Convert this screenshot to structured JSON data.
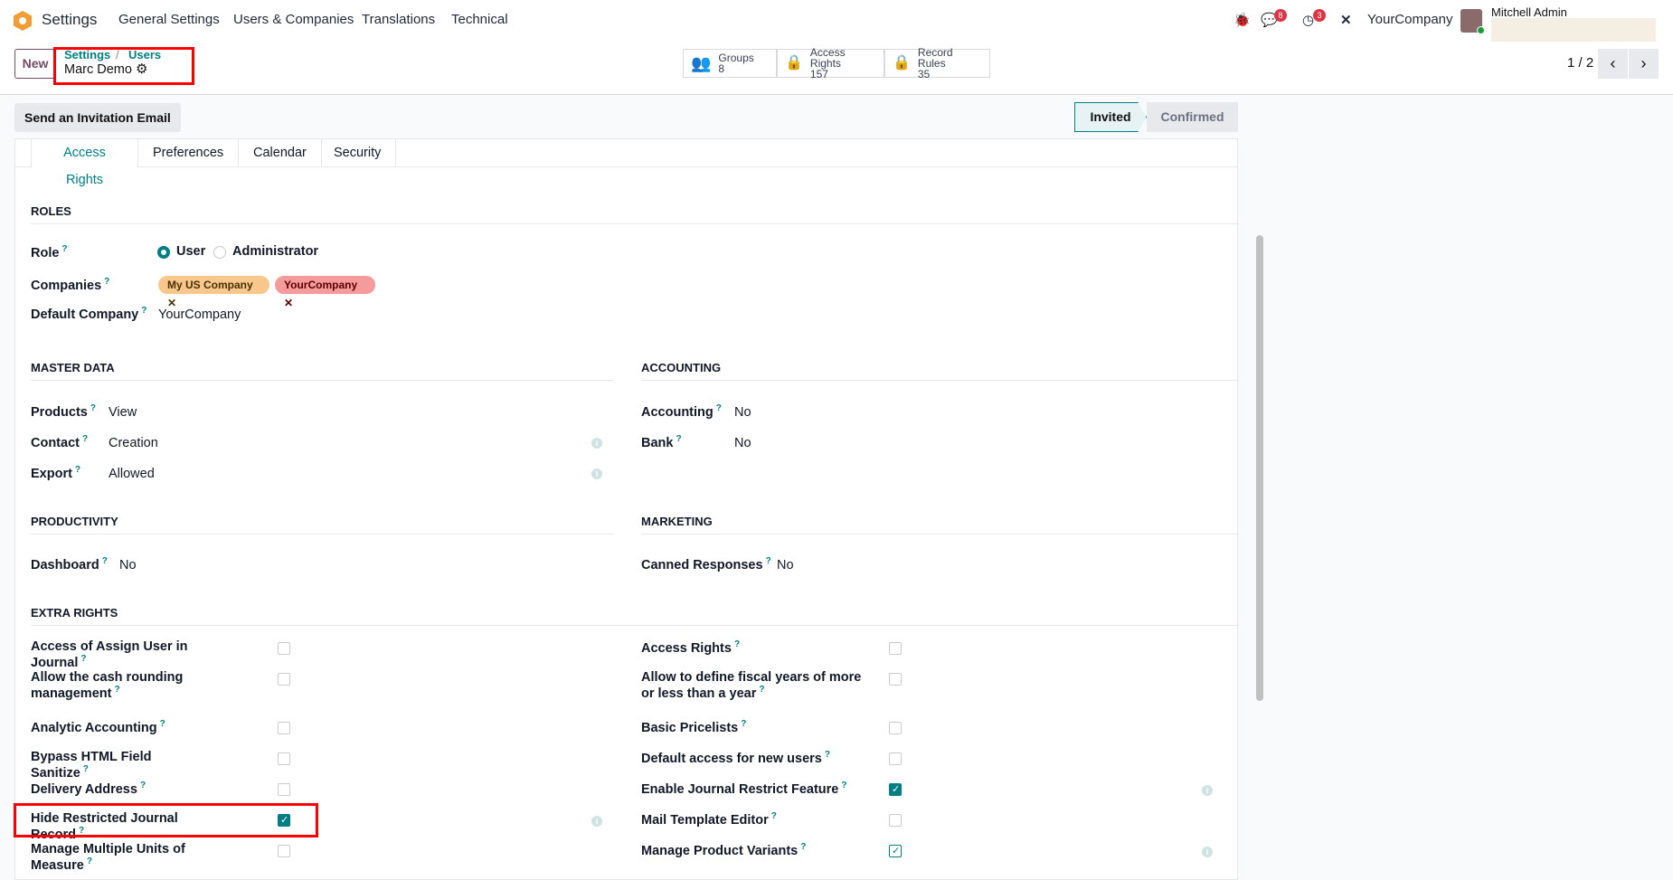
{
  "nav": {
    "app": "Settings",
    "menus": [
      "General Settings",
      "Users & Companies",
      "Translations",
      "Technical"
    ],
    "messages_count": "8",
    "activity_count": "3",
    "company": "YourCompany",
    "user": "Mitchell Admin"
  },
  "control": {
    "new": "New",
    "breadcrumb": [
      "Settings",
      "Users"
    ],
    "record": "Marc Demo",
    "stats": [
      {
        "label": "Groups",
        "value": "8"
      },
      {
        "label": "Access Rights",
        "value": "157"
      },
      {
        "label": "Record Rules",
        "value": "35"
      }
    ],
    "pager": "1 / 2"
  },
  "form": {
    "invite_button": "Send an Invitation Email",
    "status": [
      "Invited",
      "Confirmed"
    ],
    "tabs": [
      "Access Rights",
      "Preferences",
      "Calendar",
      "Security"
    ],
    "roles": {
      "title": "ROLES",
      "role_label": "Role",
      "role_options": [
        "User",
        "Administrator"
      ],
      "companies_label": "Companies",
      "companies": [
        "My US Company",
        "YourCompany"
      ],
      "default_company_label": "Default Company",
      "default_company": "YourCompany"
    },
    "master_data": {
      "title": "MASTER DATA",
      "rows": [
        {
          "label": "Products",
          "value": "View"
        },
        {
          "label": "Contact",
          "value": "Creation"
        },
        {
          "label": "Export",
          "value": "Allowed"
        }
      ]
    },
    "accounting": {
      "title": "ACCOUNTING",
      "rows": [
        {
          "label": "Accounting",
          "value": "No"
        },
        {
          "label": "Bank",
          "value": "No"
        }
      ]
    },
    "productivity": {
      "title": "PRODUCTIVITY",
      "rows": [
        {
          "label": "Dashboard",
          "value": "No"
        }
      ]
    },
    "marketing": {
      "title": "MARKETING",
      "rows": [
        {
          "label": "Canned Responses",
          "value": "No"
        }
      ]
    },
    "extra": {
      "title": "EXTRA RIGHTS",
      "left": [
        {
          "label": "Access of Assign User in Journal",
          "checked": false
        },
        {
          "label": "Allow the cash rounding management",
          "checked": false
        },
        {
          "label": "Analytic Accounting",
          "checked": false
        },
        {
          "label": "Bypass HTML Field Sanitize",
          "checked": false
        },
        {
          "label": "Delivery Address",
          "checked": false
        },
        {
          "label": "Hide Restricted Journal Record",
          "checked": true
        },
        {
          "label": "Manage Multiple Units of Measure",
          "checked": false
        }
      ],
      "right": [
        {
          "label": "Access Rights",
          "checked": false
        },
        {
          "label": "Allow to define fiscal years of more or less than a year",
          "checked": false
        },
        {
          "label": "Basic Pricelists",
          "checked": false
        },
        {
          "label": "Default access for new users",
          "checked": false
        },
        {
          "label": "Enable Journal Restrict Feature",
          "checked": true
        },
        {
          "label": "Mail Template Editor",
          "checked": false
        },
        {
          "label": "Manage Product Variants",
          "checked": true
        }
      ]
    }
  },
  "colors": {
    "accent": "#017e84",
    "brand": "#714b67"
  }
}
